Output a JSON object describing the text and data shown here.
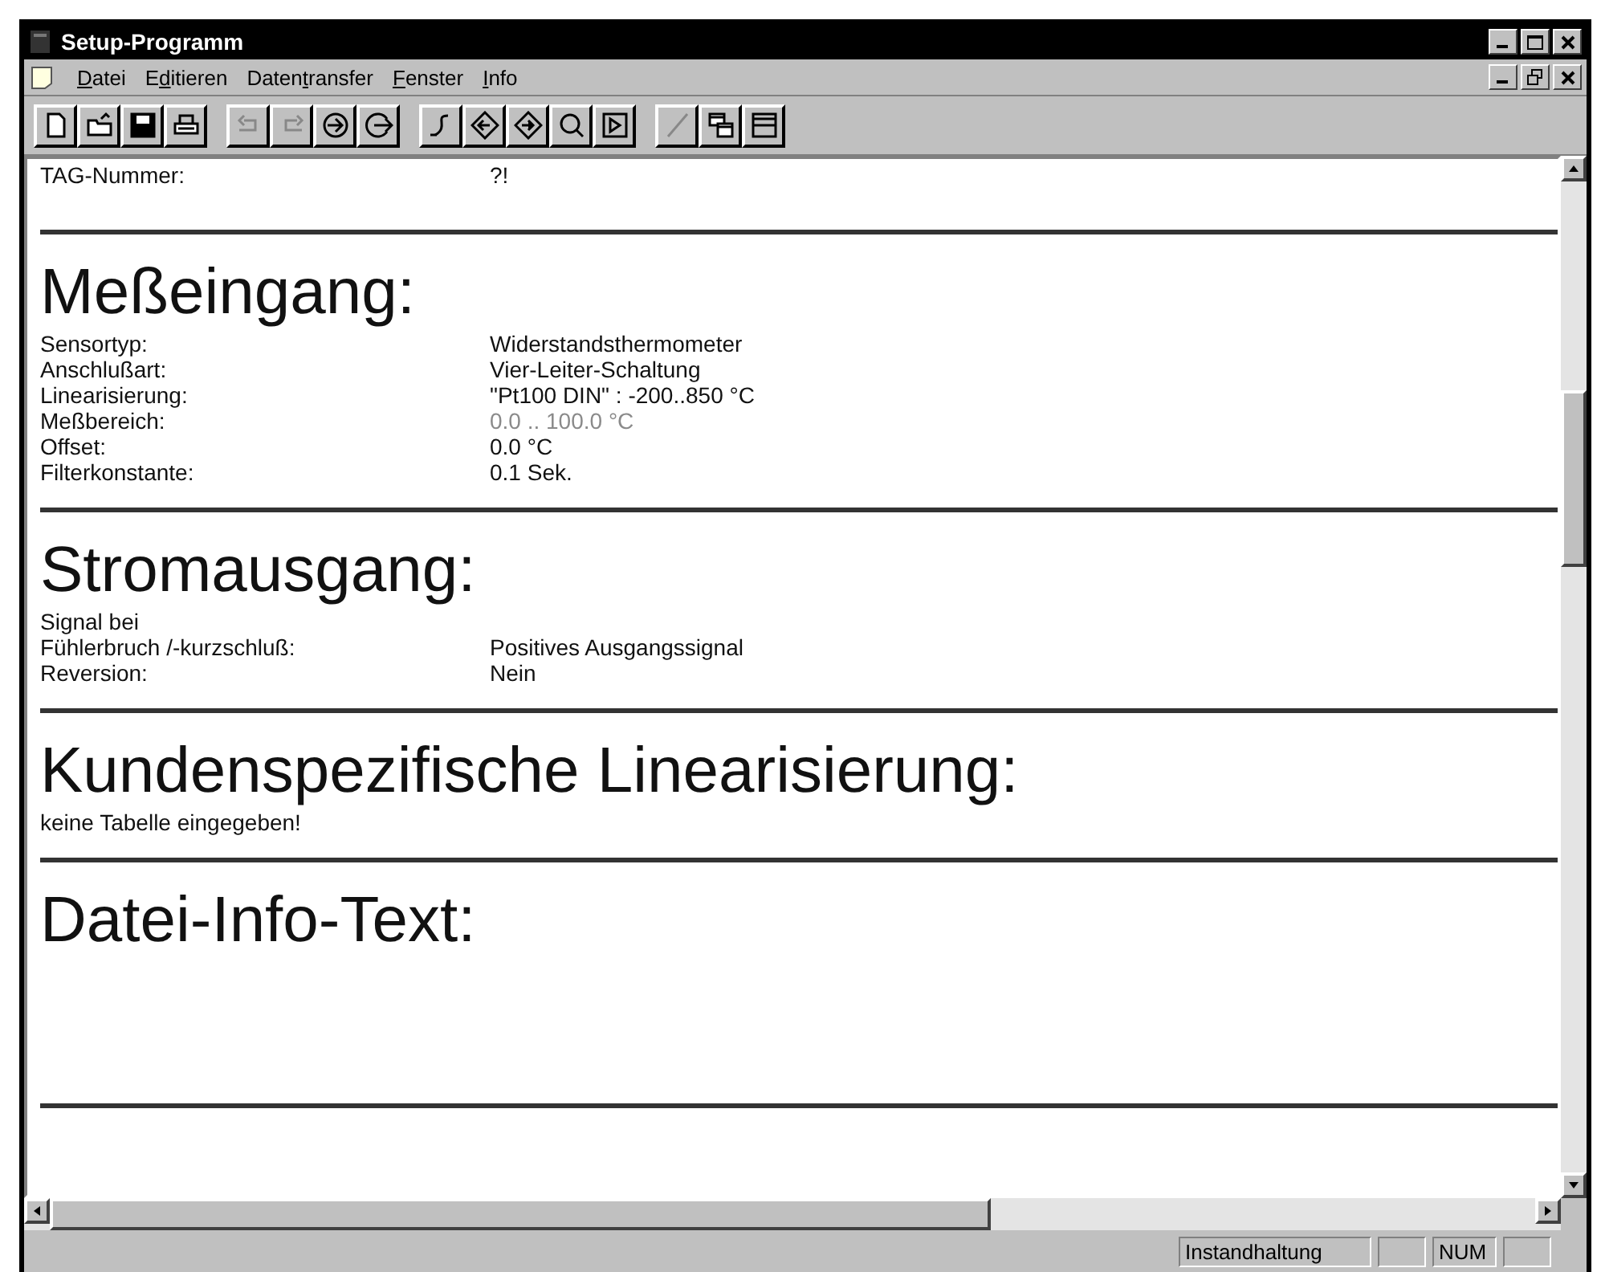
{
  "window": {
    "title": "Setup-Programm"
  },
  "menu": [
    "Datei",
    "Editieren",
    "Datentransfer",
    "Fenster",
    "Info"
  ],
  "toolbar": [
    {
      "disabled": false
    },
    {
      "disabled": false
    },
    {
      "disabled": false
    },
    {
      "disabled": false
    },
    {
      "disabled": true
    },
    {
      "disabled": true
    },
    {
      "disabled": false
    },
    {
      "disabled": false
    },
    {
      "disabled": false
    },
    {
      "disabled": false
    },
    {
      "disabled": false
    },
    {
      "disabled": false
    },
    {
      "disabled": false
    },
    {
      "disabled": true
    },
    {
      "disabled": false
    },
    {
      "disabled": false
    }
  ],
  "document": {
    "top_row": {
      "label": "TAG-Nummer:",
      "value": "?!"
    },
    "sections": [
      {
        "title": "Meßeingang:",
        "rows": [
          {
            "label": "Sensortyp:",
            "value": "Widerstandsthermometer",
            "dimmed": false
          },
          {
            "label": "Anschlußart:",
            "value": "Vier-Leiter-Schaltung",
            "dimmed": false
          },
          {
            "label": "Linearisierung:",
            "value": "\"Pt100 DIN\" : -200..850 °C",
            "dimmed": false
          },
          {
            "label": "Meßbereich:",
            "value": "0.0 .. 100.0 °C",
            "dimmed": true
          },
          {
            "label": "Offset:",
            "value": "0.0 °C",
            "dimmed": false
          },
          {
            "label": "Filterkonstante:",
            "value": "0.1 Sek.",
            "dimmed": false
          }
        ]
      },
      {
        "title": "Stromausgang:",
        "rows": [
          {
            "label": "Signal bei"
          },
          {
            "label": "Fühlerbruch /-kurzschluß:",
            "value": "Positives Ausgangssignal",
            "dimmed": false
          },
          {
            "label": "Reversion:",
            "value": "Nein",
            "dimmed": false
          }
        ]
      },
      {
        "title": "Kundenspezifische Linearisierung:",
        "rows": [
          {
            "label": "keine Tabelle eingegeben!"
          }
        ]
      },
      {
        "title": "Datei-Info-Text:"
      }
    ]
  },
  "status_bar": {
    "mode": "Instandhaltung",
    "num": "NUM"
  }
}
